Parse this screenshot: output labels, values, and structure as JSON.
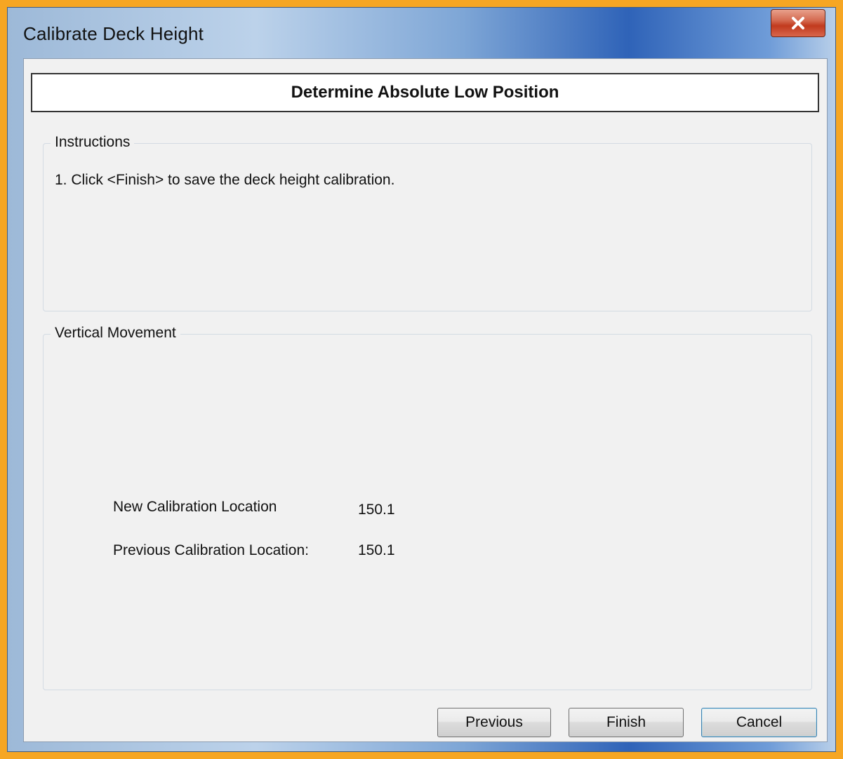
{
  "window": {
    "title": "Calibrate Deck Height",
    "close_glyph": "✕"
  },
  "header": {
    "title": "Determine Absolute Low Position"
  },
  "instructions": {
    "legend": "Instructions",
    "text": "1. Click <Finish> to save the deck height calibration."
  },
  "vertical_movement": {
    "legend": "Vertical Movement",
    "new_label": "New Calibration Location",
    "new_value": "150.1",
    "previous_label": "Previous Calibration Location:",
    "previous_value": "150.1"
  },
  "buttons": {
    "previous": "Previous",
    "finish": "Finish",
    "cancel": "Cancel"
  },
  "colors": {
    "frame_accent": "#f6a623",
    "close_button": "#c13a1e",
    "client_bg": "#f1f1f1"
  },
  "icons": {
    "close": "close-icon"
  }
}
